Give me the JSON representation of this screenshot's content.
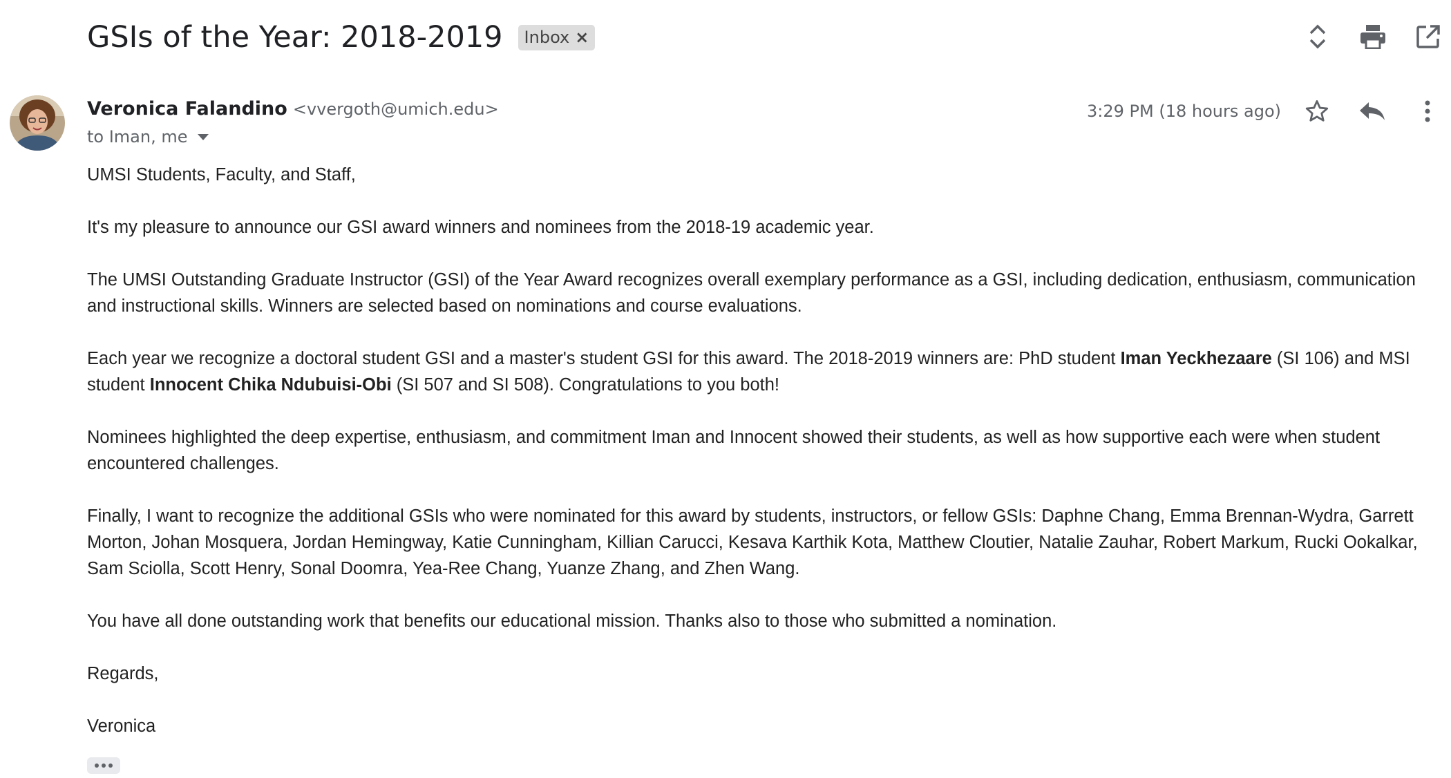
{
  "email": {
    "subject": "GSIs of the Year: 2018-2019",
    "label_badge": "Inbox",
    "label_close": "×",
    "sender": {
      "name": "Veronica Falandino",
      "email": "<vvergoth@umich.edu>"
    },
    "recipients": "to Iman, me",
    "timestamp": "3:29 PM (18 hours ago)",
    "body": {
      "greeting": "UMSI Students, Faculty, and Staff,",
      "p1": "It's my pleasure to announce our GSI award winners and nominees from the 2018-19 academic year.",
      "p2": "The UMSI Outstanding Graduate Instructor (GSI) of the Year Award recognizes overall exemplary performance as a GSI, including dedication, enthusiasm, communication and instructional skills. Winners are selected based on nominations and course evaluations.",
      "p3_a": "Each year we recognize a doctoral student GSI and a master's student GSI for this award. The 2018-2019 winners are: PhD student ",
      "p3_winner1": "Iman Yeckhezaare",
      "p3_b": " (SI 106) and MSI student ",
      "p3_winner2": "Innocent Chika Ndubuisi-Obi",
      "p3_c": " (SI 507 and SI 508). Congratulations to you both!",
      "p4": "Nominees highlighted the deep expertise, enthusiasm, and commitment Iman and Innocent showed their students, as well as how supportive each were when student encountered challenges.",
      "p5": "Finally, I want to recognize the additional GSIs who were nominated for this award by students, instructors, or fellow GSIs: Daphne Chang, Emma Brennan-Wydra, Garrett Morton, Johan Mosquera, Jordan Hemingway, Katie Cunningham, Killian Carucci, Kesava Karthik Kota, Matthew Cloutier, Natalie Zauhar, Robert Markum, Rucki Ookalkar, Sam Sciolla, Scott Henry, Sonal Doomra, Yea-Ree Chang, Yuanze Zhang, and Zhen Wang.",
      "p6": "You have all done outstanding work that benefits our educational mission. Thanks also to those who submitted a nomination.",
      "closing": "Regards,",
      "signature": "Veronica"
    }
  },
  "icons": {
    "toggle_expand": "unfold-icon",
    "print": "print-icon",
    "open_new_window": "open-in-new-window-icon",
    "star": "star-icon",
    "reply": "reply-icon",
    "more": "more-vertical-icon",
    "show_trimmed": "more-horizontal-icon"
  },
  "colors": {
    "icon": "#5f6368",
    "badge_bg": "#dddddd",
    "text": "#222222"
  }
}
